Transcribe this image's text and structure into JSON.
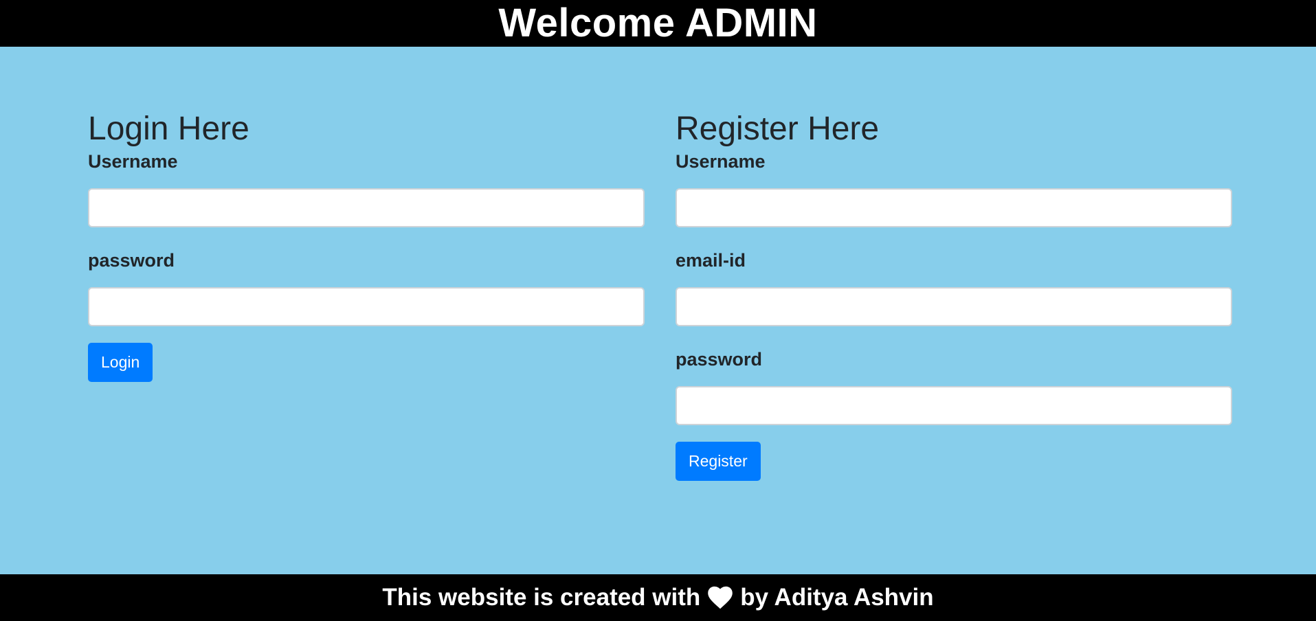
{
  "header": {
    "title": "Welcome ADMIN"
  },
  "login": {
    "heading": "Login Here",
    "username_label": "Username",
    "username_value": "",
    "password_label": "password",
    "password_value": "",
    "button_label": "Login"
  },
  "register": {
    "heading": "Register Here",
    "username_label": "Username",
    "username_value": "",
    "email_label": "email-id",
    "email_value": "",
    "password_label": "password",
    "password_value": "",
    "button_label": "Register"
  },
  "footer": {
    "text_before": "This website is created with",
    "icon": "heart-icon",
    "text_after": "by Aditya Ashvin"
  },
  "colors": {
    "background": "#87CEEB",
    "bar": "#000000",
    "button": "#007bff",
    "text": "#212529"
  }
}
